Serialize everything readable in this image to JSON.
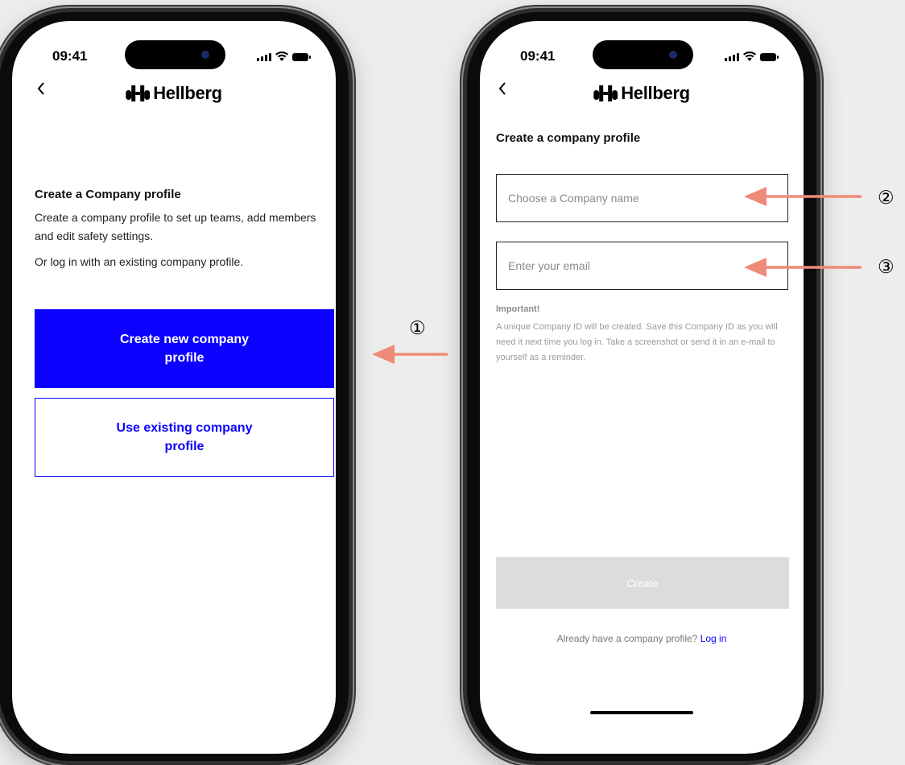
{
  "status_bar": {
    "time": "09:41"
  },
  "brand": {
    "name": "Hellberg"
  },
  "colors": {
    "primary": "#0c00ff",
    "annotation_arrow": "#f08a78",
    "disabled": "#dcdcdc"
  },
  "left_screen": {
    "back_icon": "chevron-left-icon",
    "heading": "Create a Company profile",
    "description": "Create a company profile to set up teams, add members and edit safety settings.",
    "alt_text": "Or log in with an existing company profile.",
    "primary_button": "Create new company profile",
    "secondary_button": "Use existing company profile"
  },
  "right_screen": {
    "back_icon": "chevron-left-icon",
    "heading": "Create a company profile",
    "company_name_placeholder": "Choose a Company name",
    "email_placeholder": "Enter your email",
    "important_title": "Important!",
    "important_text": "A unique Company ID will be created. Save this Company ID as you will need it next time you log in. Take a screenshot or send it in an e-mail to yourself as a reminder.",
    "create_button": "Create",
    "login_prompt": "Already have a company profile?",
    "login_link": "Log in"
  },
  "annotations": [
    "①",
    "②",
    "③"
  ]
}
